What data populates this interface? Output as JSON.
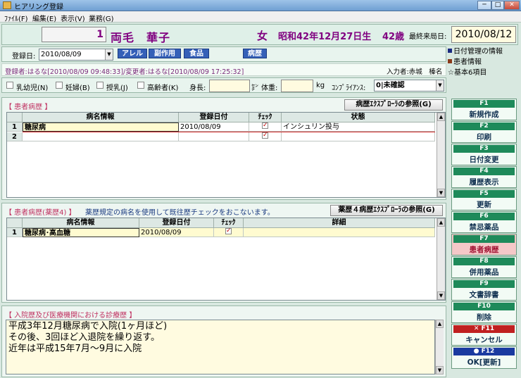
{
  "window": {
    "title": "ヒアリング登録",
    "minimize": "─",
    "maximize": "□",
    "close": "✕"
  },
  "menu": [
    "ﾌｧｲﾙ(F)",
    "編集(E)",
    "表示(V)",
    "業務(G)"
  ],
  "patient": {
    "id": "1",
    "name": "両毛　華子",
    "sex": "女",
    "birth": "昭和42年12月27日生",
    "age": "42歳",
    "last_visit_label": "最終来局日:",
    "last_visit": "2010/08/12"
  },
  "registration": {
    "date_label": "登録日:",
    "date": "2010/08/09",
    "buttons": [
      "アレル",
      "副作用",
      "食品",
      "病歴"
    ]
  },
  "legend": [
    {
      "text": "日付管理の情報",
      "color": "#1a2a80"
    },
    {
      "text": "患者情報",
      "color": "#8a3a1a"
    },
    {
      "text": "☆基本6項目",
      "color": ""
    }
  ],
  "info": {
    "registrant": "登録者:はるな[2010/08/09 09:48:33]/変更者:はるな[2010/08/09 17:25:32]",
    "input_by": "入力者:赤城　榛名"
  },
  "flags": {
    "infant": "乳幼児(N)",
    "pregnant": "妊婦(B)",
    "nursing": "授乳(J)",
    "elderly": "高齢者(K)",
    "height_label": "身長:",
    "height_unit": "㌢",
    "weight_label": "体重:",
    "weight_unit": "kg",
    "compliance_label": "ｺﾝﾌﾟﾗｲｱﾝｽ:",
    "compliance_value": "0|未確認"
  },
  "medical_history": {
    "title": "【 患者病歴 】",
    "ref_button": "病歴ｴｸｽﾌﾟﾛｰﾗの参照(G)",
    "columns": [
      "病名情報",
      "登録日付",
      "ﾁｪｯｸ",
      "状態"
    ],
    "rows": [
      {
        "no": "1",
        "disease": "糖尿病",
        "date": "2010/08/09",
        "status": "インシュリン投与"
      },
      {
        "no": "2",
        "disease": "",
        "date": "",
        "status": ""
      }
    ]
  },
  "pharmacist_history": {
    "title": "【 患者病歴(薬歴4) 】",
    "note": "薬歴規定の病名を使用して既往歴チェックをおこないます。",
    "ref_button": "薬歴４病歴ｴｸｽﾌﾟﾛｰﾗの参照(G)",
    "columns": [
      "病名情報",
      "登録日付",
      "ﾁｪｯｸ",
      "詳細"
    ],
    "rows": [
      {
        "no": "1",
        "disease": "糖尿病･高血糖",
        "date": "2010/08/09",
        "detail": ""
      }
    ]
  },
  "admission_history": {
    "title": "【 入院歴及び医療機関における診療歴 】",
    "lines": [
      "平成3年12月糖尿病で入院(1ヶ月ほど)",
      "その後、3回ほど入退院を繰り返す。",
      "近年は平成15年7月～9月に入院"
    ]
  },
  "function_keys": [
    {
      "key": "F1",
      "label": "新規作成"
    },
    {
      "key": "F2",
      "label": "印刷"
    },
    {
      "key": "F3",
      "label": "日付変更"
    },
    {
      "key": "F4",
      "label": "履歴表示"
    },
    {
      "key": "F5",
      "label": "更新"
    },
    {
      "key": "F6",
      "label": "禁忌薬品"
    },
    {
      "key": "F7",
      "label": "患者病歴"
    },
    {
      "key": "F8",
      "label": "併用薬品"
    },
    {
      "key": "F9",
      "label": "文書辞書"
    },
    {
      "key": "F10",
      "label": "削除"
    },
    {
      "key": "✕ F11",
      "label": "キャンセル"
    },
    {
      "key": "● F12",
      "label": "OK[更新]"
    }
  ]
}
